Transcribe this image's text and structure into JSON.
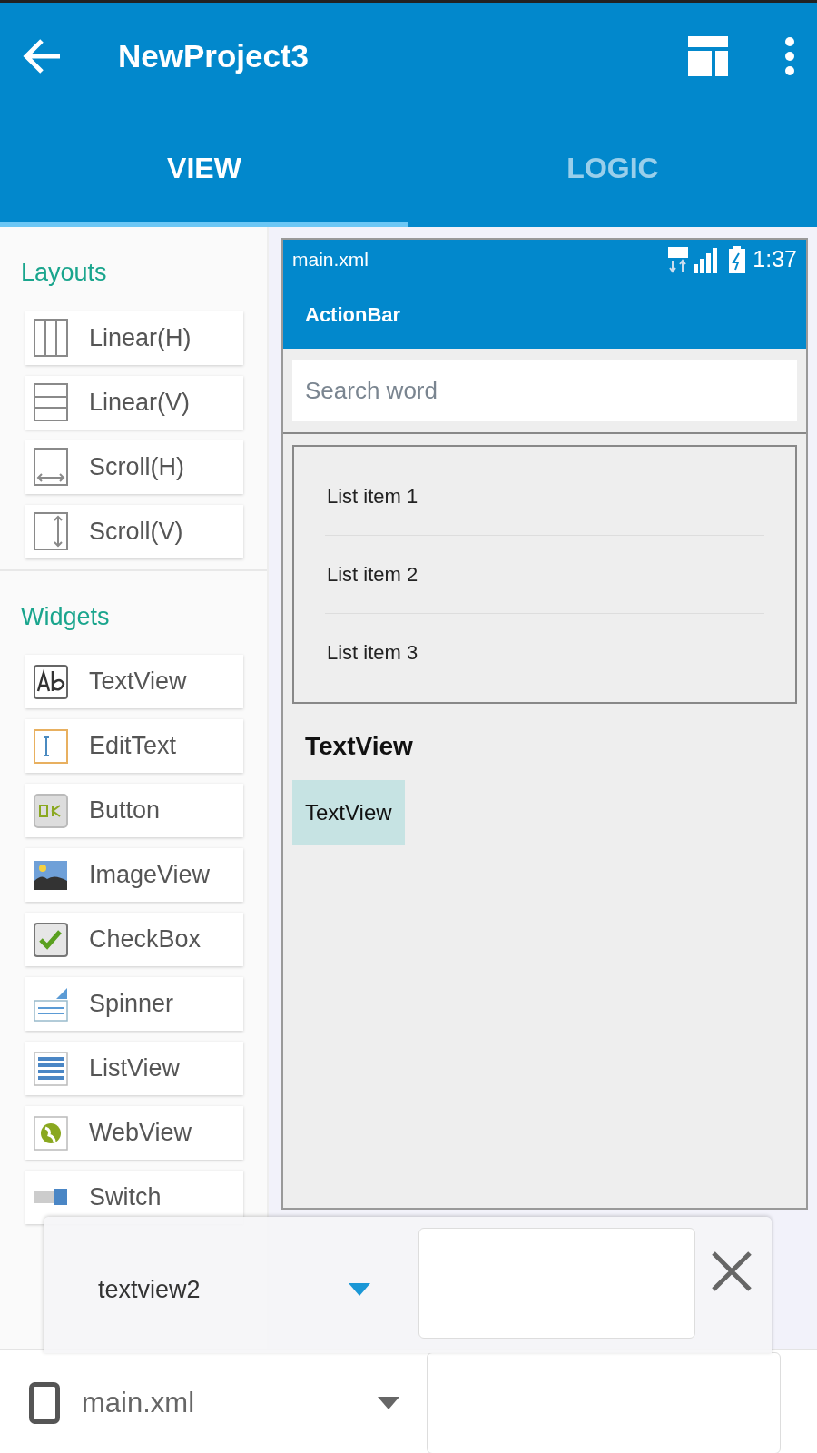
{
  "app_bar": {
    "title": "NewProject3"
  },
  "tabs": [
    {
      "label": "VIEW",
      "selected": true
    },
    {
      "label": "LOGIC",
      "selected": false
    }
  ],
  "palette": [
    {
      "title": "Layouts",
      "items": [
        {
          "label": "Linear(H)",
          "kind": "linear-h"
        },
        {
          "label": "Linear(V)",
          "kind": "linear-v"
        },
        {
          "label": "Scroll(H)",
          "kind": "scroll-h"
        },
        {
          "label": "Scroll(V)",
          "kind": "scroll-v"
        }
      ]
    },
    {
      "title": "Widgets",
      "items": [
        {
          "label": "TextView",
          "kind": "textview"
        },
        {
          "label": "EditText",
          "kind": "edittext"
        },
        {
          "label": "Button",
          "kind": "button"
        },
        {
          "label": "ImageView",
          "kind": "imageview"
        },
        {
          "label": "CheckBox",
          "kind": "checkbox"
        },
        {
          "label": "Spinner",
          "kind": "spinner"
        },
        {
          "label": "ListView",
          "kind": "listview"
        },
        {
          "label": "WebView",
          "kind": "webview"
        },
        {
          "label": "Switch",
          "kind": "switch"
        }
      ]
    }
  ],
  "preview": {
    "file": "main.xml",
    "time": "1:37",
    "action_bar": "ActionBar",
    "search": {
      "placeholder": "Search word"
    },
    "list_items": [
      "List item 1",
      "List item 2",
      "List item 3"
    ],
    "text_views": [
      {
        "text": "TextView",
        "bold": true,
        "selected": false
      },
      {
        "text": "TextView",
        "bold": false,
        "selected": true
      }
    ]
  },
  "property_bar": {
    "widget": "textview2"
  },
  "bottom_bar": {
    "file": "main.xml"
  }
}
